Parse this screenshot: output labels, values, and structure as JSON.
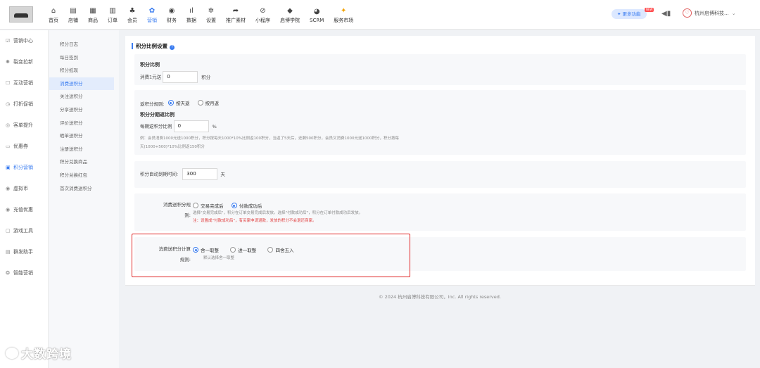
{
  "header": {
    "nav": [
      {
        "label": "首页",
        "icon": "home-icon",
        "glyph": "⌂"
      },
      {
        "label": "店铺",
        "icon": "store-icon",
        "glyph": "▤"
      },
      {
        "label": "商品",
        "icon": "goods-icon",
        "glyph": "▦"
      },
      {
        "label": "订单",
        "icon": "order-icon",
        "glyph": "▥"
      },
      {
        "label": "会员",
        "icon": "member-icon",
        "glyph": "♣"
      },
      {
        "label": "营销",
        "icon": "marketing-icon",
        "glyph": "✿",
        "active": true
      },
      {
        "label": "财务",
        "icon": "finance-icon",
        "glyph": "◉"
      },
      {
        "label": "数据",
        "icon": "data-icon",
        "glyph": "ıl"
      },
      {
        "label": "设置",
        "icon": "settings-icon",
        "glyph": "✲"
      },
      {
        "label": "推广素材",
        "icon": "share-icon",
        "glyph": "➦"
      },
      {
        "label": "小程序",
        "icon": "mini-program-icon",
        "glyph": "⊘"
      },
      {
        "label": "启博学院",
        "icon": "academy-icon",
        "glyph": "◆"
      },
      {
        "label": "SCRM",
        "icon": "scrm-icon",
        "glyph": "◕"
      },
      {
        "label": "服务市场",
        "icon": "service-market-icon",
        "glyph": "✦"
      }
    ],
    "more_label": "更多功能",
    "new_badge": "NEW",
    "company": "杭州启博科技...",
    "accent": "#3a7cf0"
  },
  "sidebar_main": [
    {
      "label": "营销中心",
      "icon": "marketing-center-icon",
      "glyph": "☑"
    },
    {
      "label": "裂变拉新",
      "icon": "fission-icon",
      "glyph": "✺"
    },
    {
      "label": "互动营销",
      "icon": "interaction-icon",
      "glyph": "☐"
    },
    {
      "label": "打折促销",
      "icon": "discount-icon",
      "glyph": "◷"
    },
    {
      "label": "客单提升",
      "icon": "order-boost-icon",
      "glyph": "◎"
    },
    {
      "label": "优惠券",
      "icon": "coupon-icon",
      "glyph": "▭"
    },
    {
      "label": "积分营销",
      "icon": "points-icon",
      "glyph": "▣",
      "active": true
    },
    {
      "label": "虚拟币",
      "icon": "virtual-coin-icon",
      "glyph": "◉"
    },
    {
      "label": "充值优惠",
      "icon": "recharge-icon",
      "glyph": "◉"
    },
    {
      "label": "游戏工具",
      "icon": "game-icon",
      "glyph": "▢"
    },
    {
      "label": "群发助手",
      "icon": "broadcast-icon",
      "glyph": "▤"
    },
    {
      "label": "智能营销",
      "icon": "smart-marketing-icon",
      "glyph": "❂"
    }
  ],
  "sidebar_sub": [
    {
      "label": "积分日志"
    },
    {
      "label": "每日签到"
    },
    {
      "label": "积分抵现"
    },
    {
      "label": "消费送积分",
      "active": true
    },
    {
      "label": "关注送积分"
    },
    {
      "label": "分享送积分"
    },
    {
      "label": "评价送积分"
    },
    {
      "label": "晒单送积分"
    },
    {
      "label": "注册送积分"
    },
    {
      "label": "积分兑换商品"
    },
    {
      "label": "积分兑换红包"
    },
    {
      "label": "首次消费送积分"
    }
  ],
  "content": {
    "section_title": "积分比例设置",
    "ratio": {
      "title": "积分比例",
      "prefix": "消费1元送",
      "value": "0",
      "suffix": "积分"
    },
    "return_rule": {
      "label": "返积分规则:",
      "options": [
        {
          "label": "按天返",
          "selected": true
        },
        {
          "label": "按月返",
          "selected": false
        }
      ],
      "period_title": "积分分期返比例",
      "period_prefix": "每期返积分比例",
      "period_value": "0",
      "period_suffix": "%",
      "example_line1": "例：会员消费1000元送1000积分，积分按每天1000*10%比例返100积分，当返了5天后，还剩500积分，会员又消费1000元送1000积分，积分按每",
      "example_line2": "天(1000+500)*10%比例返150积分"
    },
    "expire": {
      "label": "积分自动到期时间:",
      "value": "300",
      "suffix": "天"
    },
    "send_rule": {
      "label_line1": "消费送积分规",
      "label_line2": "则:",
      "options": [
        {
          "label": "交易完成后",
          "selected": false
        },
        {
          "label": "付款成功后",
          "selected": true
        }
      ],
      "hint": "选择\"交易完成后\"，积分在订单交易完成后发放。选择\"付款成功后\"，积分在订单付款成功后发放。",
      "warning": "注：设置成\"付款成功后\"，有买家申请退款，发放的积分不会退还商家。"
    },
    "calc_rule": {
      "label_line1": "消费送积分计算",
      "label_line2": "规则:",
      "options": [
        {
          "label": "舍一取整",
          "selected": true
        },
        {
          "label": "进一取整",
          "selected": false
        },
        {
          "label": "四舍五入",
          "selected": false
        }
      ],
      "hint": "默认选择舍一取整"
    }
  },
  "footer": "© 2024 杭州启博科技有限公司，Inc. All rights reserved.",
  "watermark": "大数跨境"
}
